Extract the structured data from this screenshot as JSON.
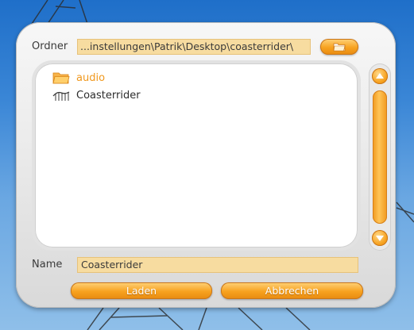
{
  "dialog": {
    "folder_label": "Ordner",
    "folder_path": "...instellungen\\Patrik\\Desktop\\coasterrider\\",
    "browse_icon": "folder-icon",
    "files": [
      {
        "name": "audio",
        "kind": "folder",
        "icon": "folder-icon"
      },
      {
        "name": "Coasterrider",
        "kind": "coaster",
        "icon": "coaster-track-icon"
      }
    ],
    "name_label": "Name",
    "name_value": "Coasterrider",
    "load_label": "Laden",
    "cancel_label": "Abbrechen"
  },
  "colors": {
    "accent_orange": "#f7a21f",
    "field_fill": "#f7dca0",
    "folder_text": "#f0981d",
    "sky": "#3a86d6"
  }
}
